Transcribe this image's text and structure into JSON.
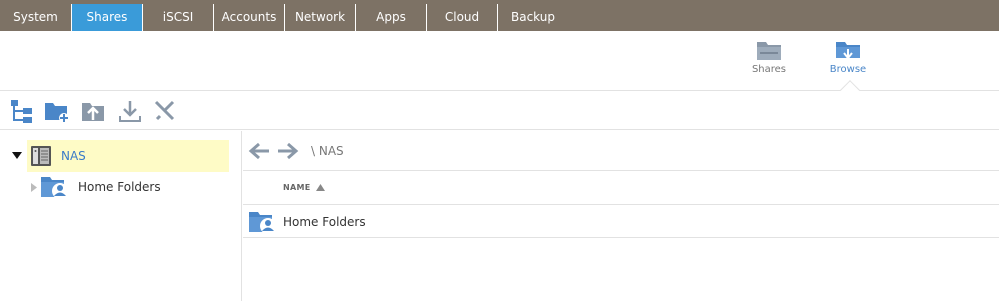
{
  "nav": {
    "tabs": [
      {
        "label": "System"
      },
      {
        "label": "Shares"
      },
      {
        "label": "iSCSI"
      },
      {
        "label": "Accounts"
      },
      {
        "label": "Network"
      },
      {
        "label": "Apps"
      },
      {
        "label": "Cloud"
      },
      {
        "label": "Backup"
      }
    ],
    "active_tab": "Shares"
  },
  "views": {
    "shares_label": "Shares",
    "browse_label": "Browse",
    "active_view": "Browse"
  },
  "toolbar": {
    "icons": [
      "tree-view-icon",
      "new-folder-icon",
      "upload-icon",
      "download-icon",
      "delete-icon"
    ]
  },
  "tree": {
    "root_label": "NAS",
    "child_label": "Home Folders"
  },
  "browser": {
    "path": "\\ NAS",
    "column_name": "NAME",
    "sort_direction": "ascending",
    "rows": [
      {
        "name": "Home Folders"
      }
    ]
  },
  "colors": {
    "nav_bg": "#7d7265",
    "nav_active": "#3a9bd9",
    "selected_row": "#fefbc6",
    "icon_blue": "#4a86c8"
  }
}
